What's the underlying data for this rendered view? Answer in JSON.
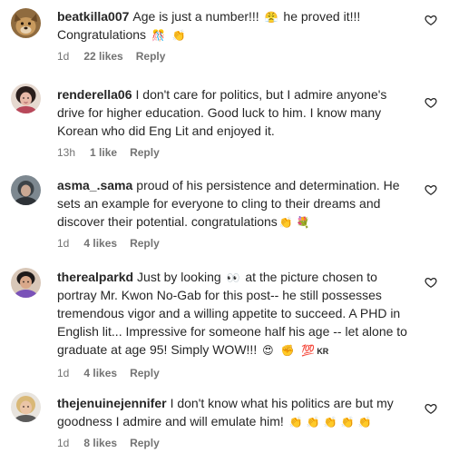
{
  "comments": [
    {
      "username": "beatkilla007",
      "text_parts": [
        "Age is just a number!!!",
        "he proved it!!!",
        "Congratulations"
      ],
      "emojis": [
        "😤",
        "🎊",
        "👏"
      ],
      "time": "1d",
      "likes": "22 likes",
      "reply": "Reply"
    },
    {
      "username": "renderella06",
      "text": "I don't care for politics, but I admire anyone's drive for higher education. Good luck to him. I know many Korean who did Eng Lit and enjoyed it.",
      "time": "13h",
      "likes": "1 like",
      "reply": "Reply"
    },
    {
      "username": "asma_.sama",
      "text": "proud of his persistence and determination. He sets an example for everyone to cling to their dreams and discover their potential. congratulations",
      "emojis": [
        "👏",
        "💐"
      ],
      "time": "1d",
      "likes": "4 likes",
      "reply": "Reply"
    },
    {
      "username": "therealparkd",
      "text_parts": [
        "Just by looking",
        "at the picture chosen to portray Mr. Kwon No-Gab for this post-- he still possesses tremendous vigor and a willing appetite to succeed. A PHD in English lit... Impressive for someone half his age -- let alone to graduate at age 95! Simply WOW!!!"
      ],
      "emojis": [
        "👀",
        "😍",
        "✊",
        "💯",
        "🇰🇷"
      ],
      "flag_text": "KR",
      "time": "1d",
      "likes": "4 likes",
      "reply": "Reply"
    },
    {
      "username": "thejenuinejennifer",
      "text": "I don't know what his politics are but my goodness I admire and will emulate him!",
      "emojis": [
        "👏",
        "👏",
        "👏",
        "👏",
        "👏"
      ],
      "time": "1d",
      "likes": "8 likes",
      "reply": "Reply"
    }
  ],
  "icons": {
    "like": "heart-icon"
  },
  "colors": {
    "text": "#262626",
    "meta": "#737373",
    "background": "#ffffff"
  }
}
